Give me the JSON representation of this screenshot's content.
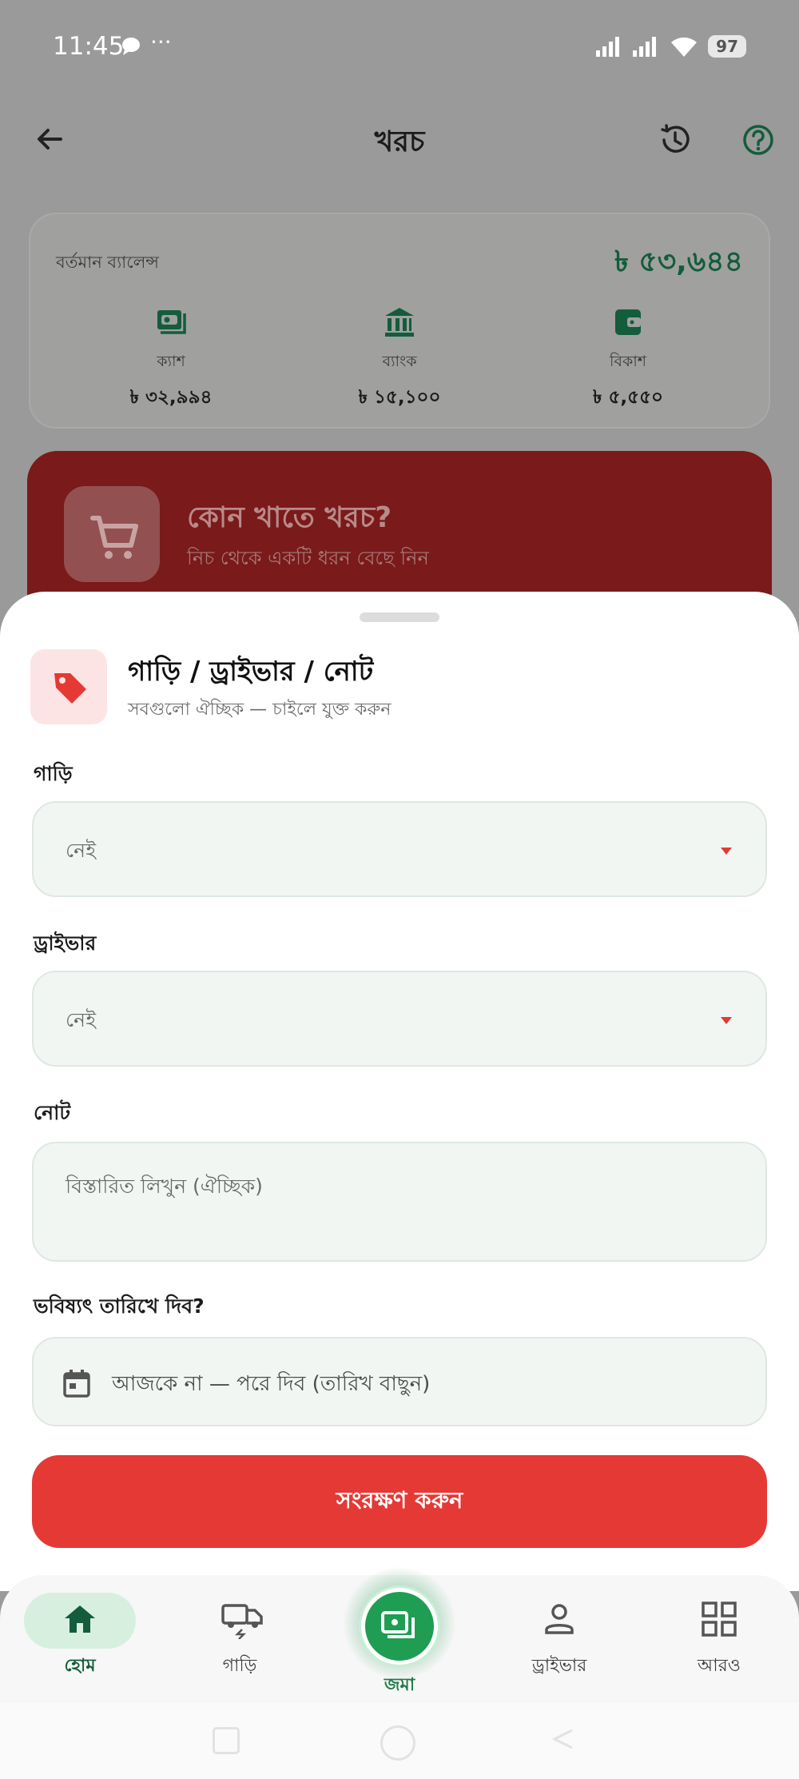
{
  "status_bar": {
    "time": "11:45",
    "dots": "···",
    "battery": "97"
  },
  "header": {
    "title": "খরচ"
  },
  "balance": {
    "label": "বর্তমান ব্যালেন্স",
    "total": "৳ ৫৩,৬৪৪",
    "accounts": [
      {
        "label": "ক্যাশ",
        "value": "৳ ৩২,৯৯৪",
        "icon": "cash-icon"
      },
      {
        "label": "ব্যাংক",
        "value": "৳ ১৫,১০০",
        "icon": "bank-icon"
      },
      {
        "label": "বিকাশ",
        "value": "৳ ৫,৫৫০",
        "icon": "wallet-icon"
      }
    ]
  },
  "banner": {
    "title": "কোন খাতে খরচ?",
    "subtitle": "নিচ থেকে একটি ধরন বেছে নিন"
  },
  "sheet": {
    "title": "গাড়ি / ড্রাইভার / নোট",
    "subtitle": "সবগুলো ঐচ্ছিক — চাইলে যুক্ত করুন",
    "vehicle": {
      "label": "গাড়ি",
      "value": "নেই"
    },
    "driver": {
      "label": "ড্রাইভার",
      "value": "নেই"
    },
    "note": {
      "label": "নোট",
      "placeholder": "বিস্তারিত লিখুন (ঐচ্ছিক)"
    },
    "future": {
      "label": "ভবিষ্যৎ তারিখে দিব?",
      "button": "আজকে না — পরে দিব (তারিখ বাছুন)"
    },
    "save": "সংরক্ষণ করুন"
  },
  "nav": {
    "items": [
      {
        "label": "হোম",
        "icon": "home-icon"
      },
      {
        "label": "গাড়ি",
        "icon": "truck-icon"
      },
      {
        "label": "জমা",
        "icon": "cash-icon"
      },
      {
        "label": "ড্রাইভার",
        "icon": "person-icon"
      },
      {
        "label": "আরও",
        "icon": "grid-icon"
      }
    ]
  },
  "colors": {
    "accent": "#e53935",
    "brand_green": "#1e9d53",
    "dark_green": "#135c3c"
  }
}
